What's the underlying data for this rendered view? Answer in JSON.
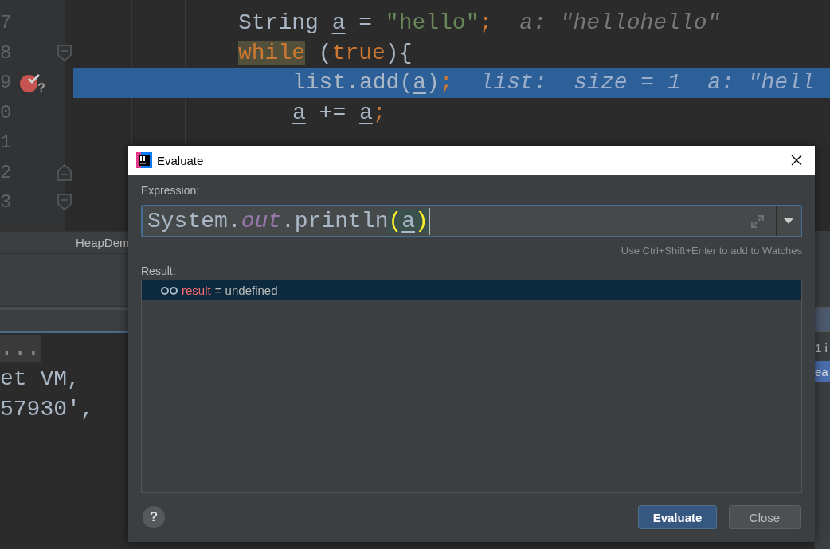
{
  "editor": {
    "lines": [
      {
        "number": "7",
        "selected": false,
        "breakpoint": false,
        "segments": [
          {
            "text": "String ",
            "kind": "plain"
          },
          {
            "text": "a",
            "kind": "var"
          },
          {
            "text": " = ",
            "kind": "plain"
          },
          {
            "text": "\"hello\"",
            "kind": "string"
          },
          {
            "text": ";",
            "kind": "semi"
          }
        ],
        "hint": "a: \"hellohello\""
      },
      {
        "number": "8",
        "selected": false,
        "breakpoint": false,
        "fold": {
          "kind": "open"
        },
        "segments": [
          {
            "text": "while",
            "kind": "marked-keyword"
          },
          {
            "text": " (",
            "kind": "plain"
          },
          {
            "text": "true",
            "kind": "keyword"
          },
          {
            "text": "){",
            "kind": "plain"
          }
        ],
        "children": [
          {
            "number": "9",
            "selected": true,
            "breakpoint": true,
            "breakpoint_badge": "?",
            "segments": [
              {
                "text": "list.add(",
                "kind": "plain"
              },
              {
                "text": "a",
                "kind": "var"
              },
              {
                "text": ")",
                "kind": "plain"
              },
              {
                "text": ";",
                "kind": "semi"
              }
            ],
            "hint": "list:  size = 1  a: \"hell"
          },
          {
            "number": "0",
            "selected": false,
            "breakpoint": false,
            "segments": [
              {
                "text": "a",
                "kind": "var"
              },
              {
                "text": " += ",
                "kind": "plain"
              },
              {
                "text": "a",
                "kind": "var"
              },
              {
                "text": ";",
                "kind": "semi"
              }
            ]
          },
          {
            "number": "1",
            "selected": false,
            "breakpoint": false
          }
        ]
      },
      {
        "number": "2",
        "selected": false,
        "breakpoint": false,
        "fold": {
          "kind": "close"
        }
      },
      {
        "number": "3",
        "selected": false,
        "breakpoint": false,
        "fold": {
          "kind": "open"
        }
      }
    ]
  },
  "bottom_panel": {
    "tab": "HeapDem",
    "console": [
      {
        "text": "...",
        "kind": "fold"
      },
      {
        "text": "et VM,",
        "kind": "plain"
      },
      {
        "text": "57930',",
        "kind": "plain"
      }
    ],
    "side_panel": [
      {
        "text": "1 i",
        "kind": "plain"
      },
      {
        "text": "ea",
        "kind": "chip"
      }
    ]
  },
  "dialog": {
    "title": "Evaluate",
    "expression_label": "Expression:",
    "expression": [
      {
        "text": "System.",
        "kind": "plain"
      },
      {
        "text": "out",
        "kind": "field"
      },
      {
        "text": ".println",
        "kind": "plain"
      },
      {
        "text": "(",
        "kind": "brace"
      },
      {
        "text": "a",
        "kind": "var"
      },
      {
        "text": ")",
        "kind": "brace"
      }
    ],
    "hint": "Use Ctrl+Shift+Enter to add to Watches",
    "result_label": "Result:",
    "results": [
      {
        "name": "result",
        "value": "= undefined",
        "selected": true
      }
    ],
    "help": "?",
    "buttons": [
      {
        "label": "Evaluate",
        "kind": "primary"
      },
      {
        "label": "Close",
        "kind": "secondary"
      }
    ]
  }
}
